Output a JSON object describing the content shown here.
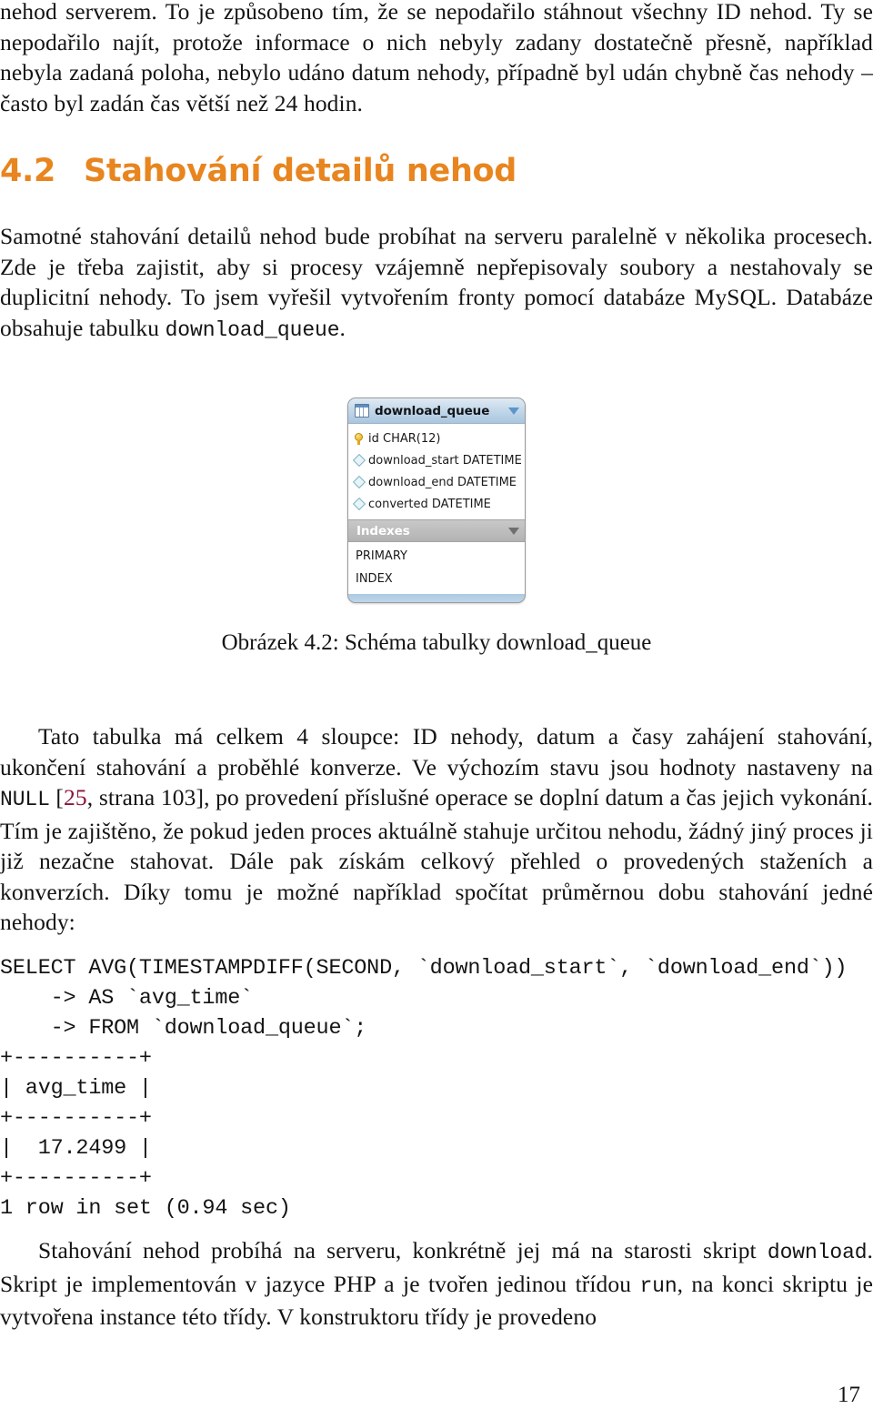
{
  "document": {
    "language": "cs",
    "page_number": "17",
    "accent_color": "#E8851F",
    "citation_color": "#8A1538"
  },
  "top_paragraph": {
    "text": "nehod serverem. To je způsobeno tím, že se nepodařilo stáhnout všechny ID nehod. Ty se nepodařilo najít, protože informace o nich nebyly zadany dostatečně přesně, například nebyla zadaná poloha, nebylo udáno datum nehody, případně byl udán chybně čas nehody – často byl zadán čas větší než 24 hodin."
  },
  "section": {
    "number": "4.2",
    "title": "Stahování detailů nehod"
  },
  "intro_paragraph": {
    "part1": "Samotné stahování detailů nehod bude probíhat na serveru paralelně v několika procesech. Zde je třeba zajistit, aby si procesy vzájemně nepřepisovaly soubory a nestahovaly se duplicitní nehody. To jsem vyřešil vytvořením fronty pomocí databáze MySQL. Databáze obsahuje tabulku ",
    "table_name": "download_queue",
    "part2": "."
  },
  "figure": {
    "caption_prefix": "Obrázek 4.2: Schéma tabulky ",
    "caption_table": "download_queue",
    "diagram": {
      "type": "mysql-workbench-table",
      "title": "download_queue",
      "title_icon": "table-icon",
      "collapse_icon": "triangle-down-icon",
      "fields": [
        {
          "icon": "primary-key-icon",
          "name": "id",
          "type": "CHAR(12)"
        },
        {
          "icon": "column-diamond-icon",
          "name": "download_start",
          "type": "DATETIME"
        },
        {
          "icon": "column-diamond-icon",
          "name": "download_end",
          "type": "DATETIME"
        },
        {
          "icon": "column-diamond-icon",
          "name": "converted",
          "type": "DATETIME"
        }
      ],
      "indexes_section_label": "Indexes",
      "indexes": [
        "PRIMARY",
        "INDEX"
      ],
      "colors": {
        "header_fill": "#C5D9EA",
        "body_fill": "#FFFFFF",
        "indexes_fill": "#BDBDBD",
        "border": "#9A9A9A",
        "footer_fill": "#B3CCE4"
      }
    }
  },
  "description_paragraph": {
    "part1": "Tato tabulka má celkem 4 sloupce: ID nehody, datum a časy zahájení stahování, ukončení stahování a proběhlé konverze. Ve výchozím stavu jsou hodnoty nastaveny na ",
    "null_literal": "NULL",
    "part2": " [",
    "citation_ref": "25",
    "part3": ", strana 103], po provedení příslušné operace se doplní datum a čas jejich vykonání. Tím je zajištěno, že pokud jeden proces aktuálně stahuje určitou nehodu, žádný jiný proces ji již nezačne stahovat. Dále pak získám celkový přehled o provedených staženích a konverzích. Díky tomu je možné například spočítat průměrnou dobu stahování jedné nehody:"
  },
  "code_block": {
    "lines": [
      "SELECT AVG(TIMESTAMPDIFF(SECOND, `download_start`, `download_end`))",
      "    -> AS `avg_time`",
      "    -> FROM `download_queue`;",
      "+----------+",
      "| avg_time |",
      "+----------+",
      "|  17.2499 |",
      "+----------+",
      "1 row in set (0.94 sec)"
    ],
    "result": {
      "column": "avg_time",
      "value": "17.2499",
      "rows": "1 row in set",
      "duration": "0.94 sec"
    }
  },
  "outro_paragraph": {
    "part1": "Stahování nehod probíhá na serveru, konkrétně jej má na starosti skript ",
    "script_name": "download",
    "part2": ". Skript je implementován v jazyce PHP a je tvořen jedinou třídou ",
    "class_name": "run",
    "part3": ", na konci skriptu je vytvořena instance této třídy. V konstruktoru třídy je provedeno"
  }
}
